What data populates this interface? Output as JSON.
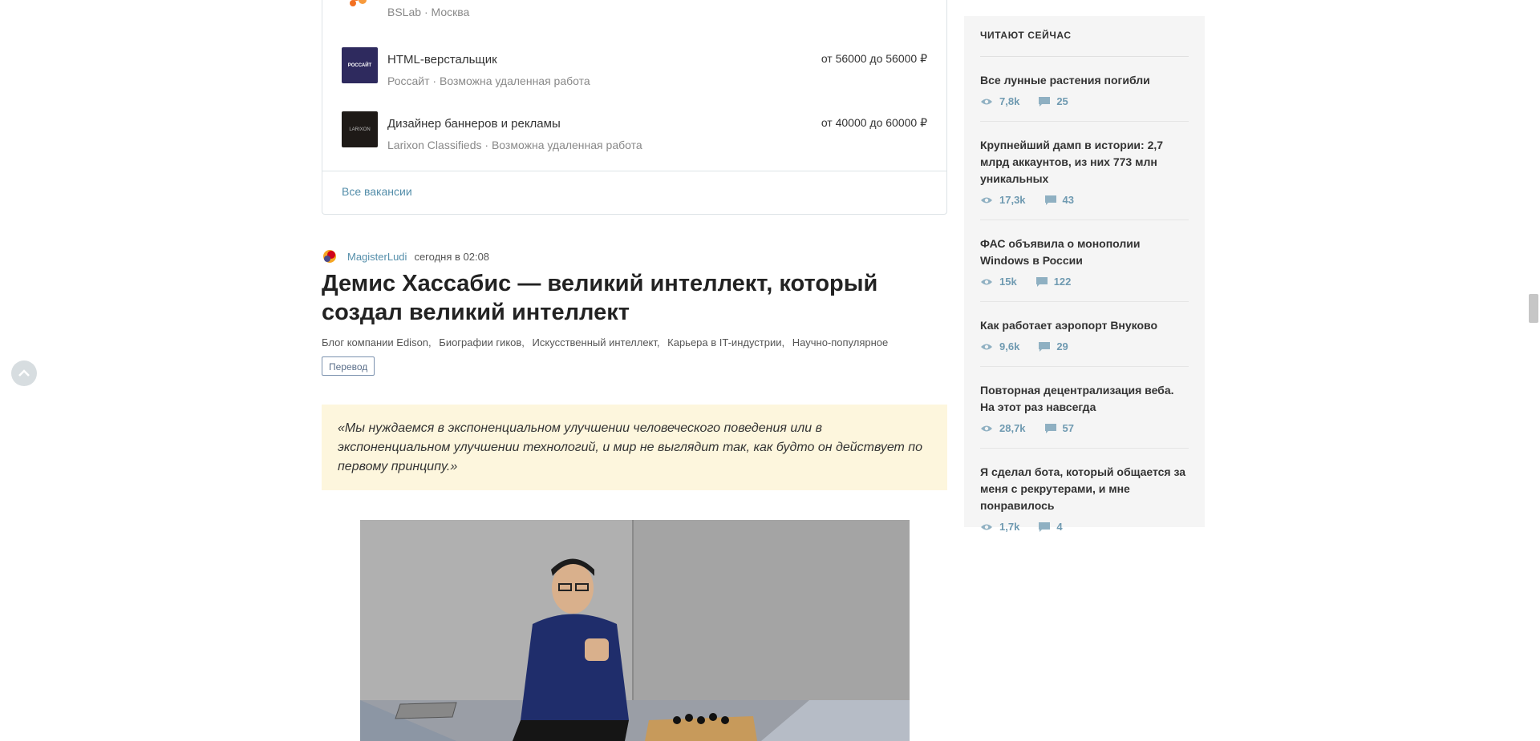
{
  "vacancies": {
    "items": [
      {
        "title": "",
        "company": "BSLab",
        "location": "Москва",
        "salary": "",
        "logo_text": "BSLab",
        "logo_color": "#ffffff"
      },
      {
        "title": "HTML-верстальщик",
        "company": "Россайт",
        "location": "Возможна удаленная работа",
        "salary": "от 56000 до 56000 ₽",
        "logo_text": "РОССАЙТ",
        "logo_color": "#2e2a5e"
      },
      {
        "title": "Дизайнер баннеров и рекламы",
        "company": "Larixon Classifieds",
        "location": "Возможна удаленная работа",
        "salary": "от 40000 до 60000 ₽",
        "logo_text": "LARIXON",
        "logo_color": "#1e1a17"
      }
    ],
    "separator": "·",
    "all_link": "Все вакансии"
  },
  "article": {
    "author": "MagisterLudi",
    "time": "сегодня в 02:08",
    "title": "Демис Хассабис — великий интеллект, который создал великий интеллект",
    "hubs": [
      "Блог компании Edison,",
      "Биографии гиков,",
      "Искусственный интеллект,",
      "Карьера в IT-индустрии,",
      "Научно-популярное"
    ],
    "badge": "Перевод",
    "quote": "«Мы нуждаемся в экспоненциальном улучшении человеческого поведения или в экспоненциальном улучшении технологий, и мир не выглядит так, как будто он действует по первому принципу.»"
  },
  "sidebar": {
    "title": "ЧИТАЮТ СЕЙЧАС",
    "items": [
      {
        "title": "Все лунные растения погибли",
        "views": "7,8k",
        "comments": "25"
      },
      {
        "title": "Крупнейший дамп в истории: 2,7 млрд аккаунтов, из них 773 млн уникальных",
        "views": "17,3k",
        "comments": "43"
      },
      {
        "title": "ФАС объявила о монополии Windows в России",
        "views": "15k",
        "comments": "122"
      },
      {
        "title": "Как работает аэропорт Внуково",
        "views": "9,6k",
        "comments": "29"
      },
      {
        "title": "Повторная децентрализация веба. На этот раз навсегда",
        "views": "28,7k",
        "comments": "57"
      },
      {
        "title": "Я сделал бота, который общается за меня с рекрутерами, и мне понравилось",
        "views": "1,7k",
        "comments": "4"
      }
    ]
  },
  "colors": {
    "link": "#548eaa",
    "stat": "#6f9ab1",
    "quote_bg": "#fdf6dd",
    "sidebar_bg": "#f5f5f5"
  }
}
